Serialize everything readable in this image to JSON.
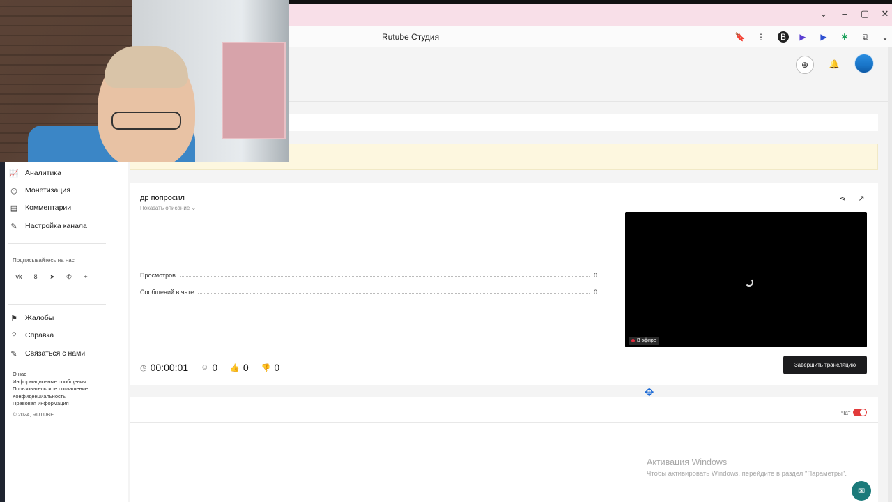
{
  "browser": {
    "title": "Rutube Студия",
    "window_controls": {
      "min": "–",
      "restore": "▢",
      "close": "✕",
      "chevron": "⌄"
    }
  },
  "header": {
    "add_icon": "⊕",
    "bell_icon": "🔔"
  },
  "sidebar": {
    "items": [
      {
        "label": "Аналитика",
        "icon": "📈"
      },
      {
        "label": "Монетизация",
        "icon": "◎"
      },
      {
        "label": "Комментарии",
        "icon": "▤"
      },
      {
        "label": "Настройка канала",
        "icon": "✎"
      }
    ],
    "subscribe_title": "Подписывайтесь на нас",
    "social": [
      "vk",
      "ok",
      "tg",
      "vb",
      "+"
    ],
    "support": [
      {
        "label": "Жалобы",
        "icon": "⚑"
      },
      {
        "label": "Справка",
        "icon": "?"
      },
      {
        "label": "Связаться с нами",
        "icon": "✎"
      }
    ],
    "footer": [
      "О нас",
      "Информационные сообщения",
      "Пользовательское соглашение",
      "Конфиденциальность",
      "Правовая информация",
      "© 2024, RUTUBE"
    ]
  },
  "stream": {
    "title": "др попросил",
    "show_description": "Показать описание ⌄",
    "stats": [
      {
        "label": "Просмотров",
        "value": "0"
      },
      {
        "label": "Сообщений в чате",
        "value": "0"
      }
    ],
    "live_label": "В эфире",
    "metrics": {
      "duration": "00:00:01",
      "viewers": "0",
      "likes": "0",
      "dislikes": "0"
    },
    "end_button": "Завершить трансляцию"
  },
  "chat": {
    "label": "Чат",
    "enabled": true
  },
  "windows_activation": {
    "title": "Активация Windows",
    "subtitle": "Чтобы активировать Windows, перейдите в раздел \"Параметры\"."
  },
  "colors": {
    "accent": "#e23b3b",
    "button_dark": "#1c1c1e",
    "notice_bg": "#fdf7df"
  }
}
